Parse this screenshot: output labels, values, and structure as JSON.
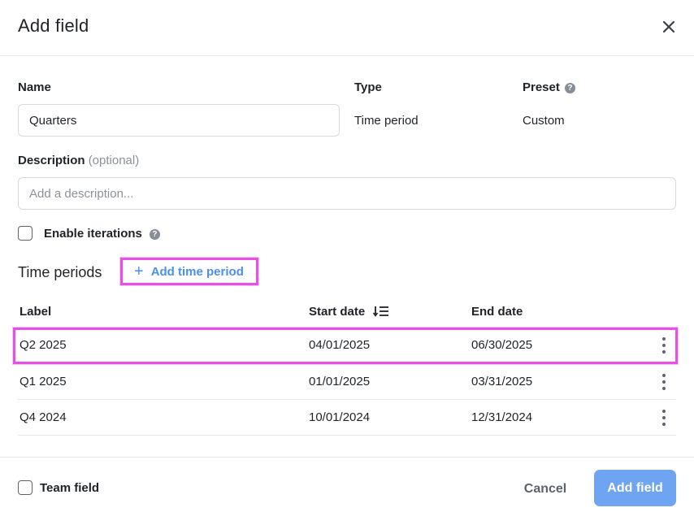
{
  "dialog": {
    "title": "Add field",
    "close_icon": "close-icon"
  },
  "form": {
    "name_label": "Name",
    "name_value": "Quarters",
    "type_label": "Type",
    "type_value": "Time period",
    "preset_label": "Preset",
    "preset_help_icon": "question-icon",
    "preset_value": "Custom",
    "description_label": "Description",
    "description_optional": "(optional)",
    "description_placeholder": "Add a description...",
    "description_value": "",
    "iterations_label": "Enable iterations",
    "iterations_help_icon": "question-icon",
    "iterations_checked": false
  },
  "time_periods": {
    "title": "Time periods",
    "add_label": "Add time period",
    "add_icon": "plus-icon",
    "columns": {
      "label": "Label",
      "start": "Start date",
      "start_sort_icon": "sort-descending-icon",
      "end": "End date"
    },
    "rows": [
      {
        "label": "Q2 2025",
        "start": "04/01/2025",
        "end": "06/30/2025"
      },
      {
        "label": "Q1 2025",
        "start": "01/01/2025",
        "end": "03/31/2025"
      },
      {
        "label": "Q4 2024",
        "start": "10/01/2024",
        "end": "12/31/2024"
      }
    ]
  },
  "footer": {
    "team_field_label": "Team field",
    "team_field_checked": false,
    "cancel_label": "Cancel",
    "submit_label": "Add field"
  },
  "colors": {
    "primary_button": "#6fa4f2",
    "link": "#4a90ea",
    "highlight_outline": "#e84fe6"
  }
}
